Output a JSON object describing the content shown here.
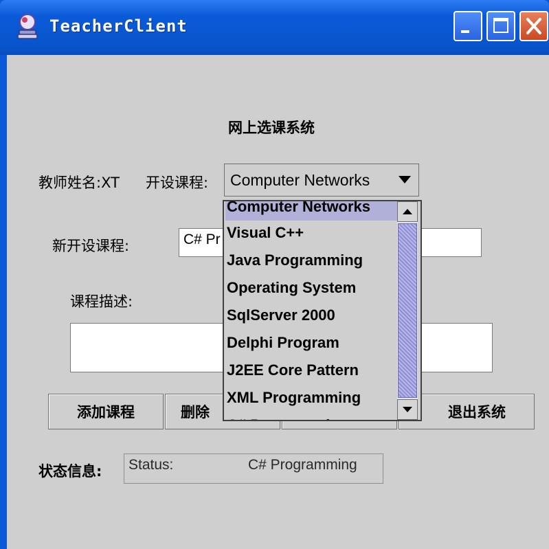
{
  "window": {
    "title": "TeacherClient",
    "icon": "app-icon",
    "controls": [
      "minimize-icon",
      "maximize-icon",
      "close-icon"
    ]
  },
  "form": {
    "heading": "网上选课系统",
    "teacher_label": "教师姓名:XT",
    "course_label": "开设课程:",
    "course_select": {
      "selected": "Computer Networks",
      "options": [
        "Computer Networks",
        "Visual C++",
        "Java Programming",
        "Operating System",
        "SqlServer 2000",
        "Delphi Program",
        "J2EE Core Pattern",
        "XML Programming",
        "C# Programming"
      ]
    },
    "new_course_label": "新开设课程:",
    "new_course_value": "C# Pr",
    "description_label": "课程描述:",
    "description_value": "",
    "buttons": {
      "add": "添加课程",
      "delete": "删除",
      "exit": "退出系统"
    },
    "status_label": "状态信息:",
    "status_prefix": "Status:",
    "status_value": "C# Programming"
  },
  "colors": {
    "titlebar": "#0a5ad8",
    "client_bg": "#cfcfcf",
    "selection": "#b0b0d8",
    "close_button": "#d5562e"
  }
}
